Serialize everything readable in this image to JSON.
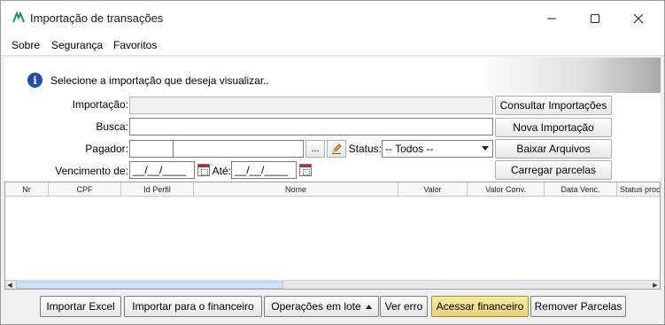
{
  "window": {
    "title": "Importação de transações",
    "controls": {
      "minimize": "—",
      "maximize": "☐",
      "close": "✕"
    }
  },
  "menu": {
    "items": [
      "Sobre",
      "Segurança",
      "Favoritos"
    ]
  },
  "info": {
    "icon": "info-icon",
    "text": "Selecione a importação que deseja visualizar.."
  },
  "form": {
    "importacao_label": "Importação:",
    "importacao_value": "",
    "busca_label": "Busca:",
    "busca_value": "",
    "pagador_label": "Pagador:",
    "pagador_code": "",
    "pagador_name": "",
    "ellipsis_label": "...",
    "status_label": "Status:",
    "status_value": "-- Todos --",
    "vencimento_label": "Vencimento de:",
    "vencimento_de": "__/__/____",
    "ate_label": "Até:",
    "vencimento_ate": "__/__/____"
  },
  "side_buttons": {
    "consultar": "Consultar Importações",
    "nova": "Nova Importação",
    "baixar": "Baixar Arquivos",
    "carregar": "Carregar parcelas"
  },
  "grid": {
    "columns": [
      "Nr",
      "CPF",
      "Id Perfil",
      "Nome",
      "Valor",
      "Valor Conv.",
      "Data Venc.",
      "Status proc"
    ],
    "rows": []
  },
  "footer": {
    "importar_excel": "Importar Excel",
    "importar_financeiro": "Importar para o financeiro",
    "operacoes": "Operações em lote",
    "ver_erro": "Ver erro",
    "acessar": "Acessar financeiro",
    "remover": "Remover Parcelas"
  },
  "colors": {
    "accent_highlight": "#ead476",
    "info_icon": "#1f4fa8",
    "app_icon": "#1a8f6e"
  }
}
